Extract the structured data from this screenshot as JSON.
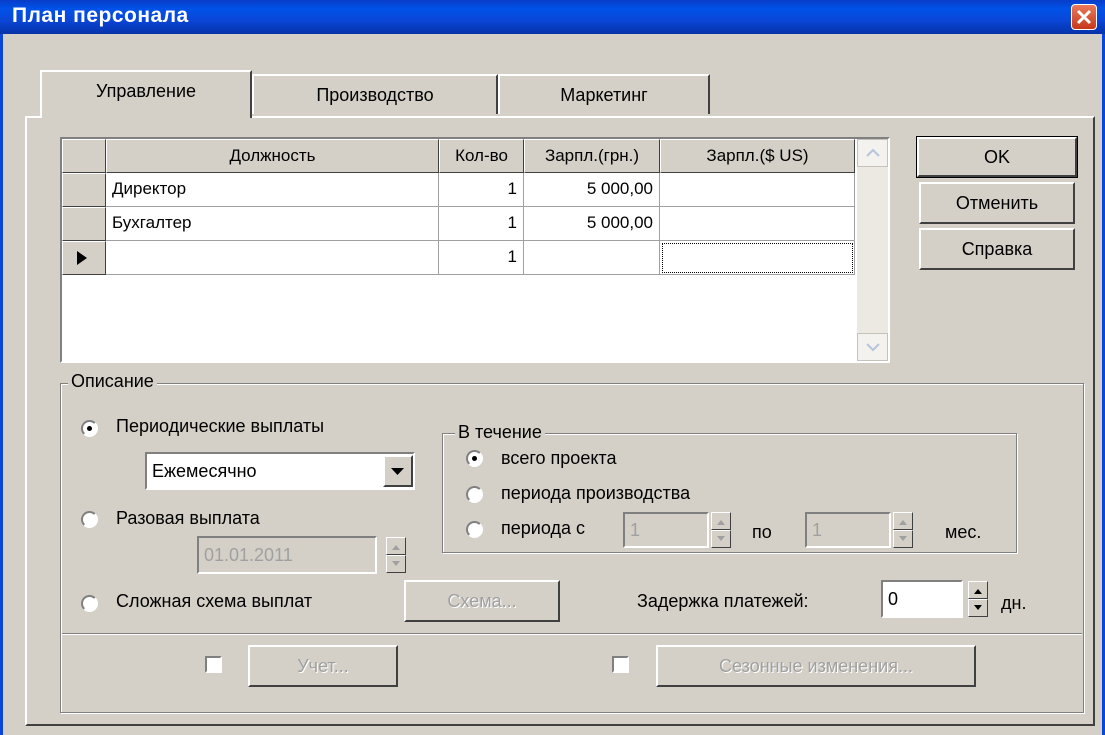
{
  "window": {
    "title": "План персонала"
  },
  "tabs": [
    {
      "label": "Управление",
      "active": true
    },
    {
      "label": "Производство",
      "active": false
    },
    {
      "label": "Маркетинг",
      "active": false
    }
  ],
  "grid": {
    "columns": [
      "Должность",
      "Кол-во",
      "Зарпл.(грн.)",
      "Зарпл.($ US)"
    ],
    "rows": [
      {
        "position": "Директор",
        "qty": "1",
        "salary_uah": "5 000,00",
        "salary_usd": ""
      },
      {
        "position": "Бухгалтер",
        "qty": "1",
        "salary_uah": "5 000,00",
        "salary_usd": ""
      },
      {
        "position": "",
        "qty": "1",
        "salary_uah": "",
        "salary_usd": ""
      }
    ]
  },
  "buttons": {
    "ok": "OK",
    "cancel": "Отменить",
    "help": "Справка"
  },
  "description": {
    "legend": "Описание",
    "periodic_label": "Периодические выплаты",
    "periodic_selected": true,
    "frequency_value": "Ежемесячно",
    "onetime_label": "Разовая выплата",
    "onetime_date": "01.01.2011",
    "complex_label": "Сложная схема выплат",
    "scheme_button": "Схема...",
    "during": {
      "legend": "В течение",
      "whole_project": "всего проекта",
      "production_period": "периода производства",
      "period_from": "периода с",
      "from_value": "1",
      "to_label": "по",
      "to_value": "1",
      "unit": "мес."
    },
    "delay_label": "Задержка платежей:",
    "delay_value": "0",
    "delay_unit": "дн.",
    "accounting_button": "Учет...",
    "seasonal_button": "Сезонные изменения..."
  },
  "colors": {
    "titlebar": "#0a46d8",
    "face": "#d4d0c8",
    "close": "#d9522e"
  }
}
